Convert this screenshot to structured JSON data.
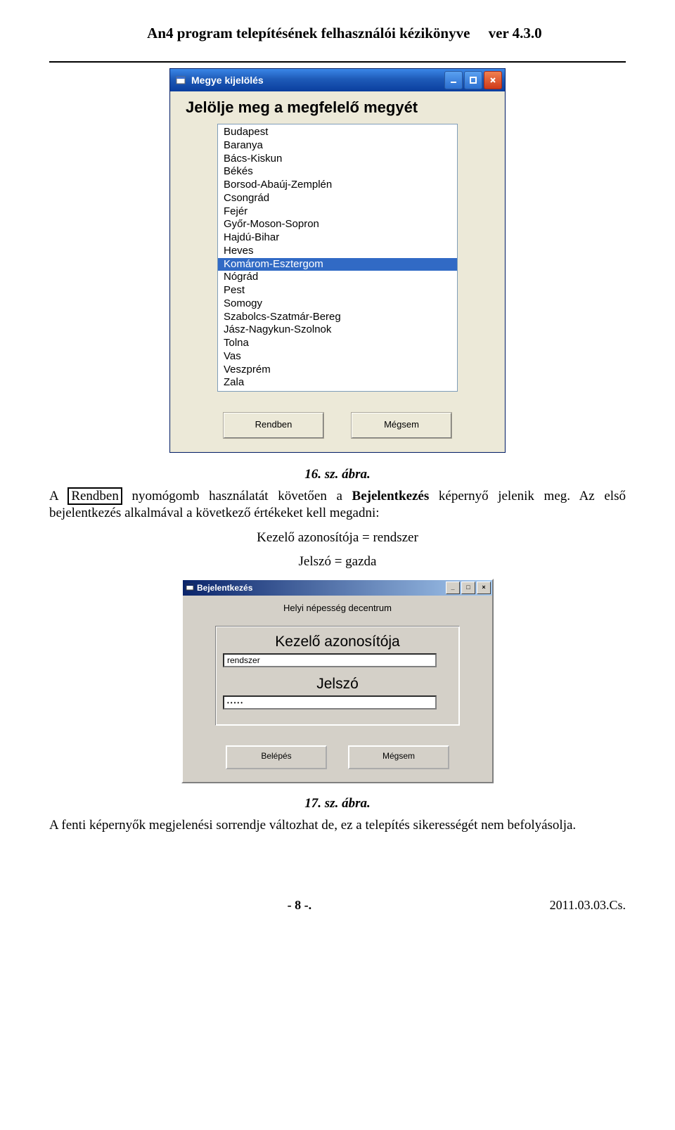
{
  "header": {
    "title_left": "An4 program telepítésének felhasználói kézikönyve",
    "title_right": "ver 4.3.0"
  },
  "figure1": {
    "window_title": "Megye kijelölés",
    "heading": "Jelölje meg a megfelelő megyét",
    "items": [
      "Budapest",
      "Baranya",
      "Bács-Kiskun",
      "Békés",
      "Borsod-Abaúj-Zemplén",
      "Csongrád",
      "Fejér",
      "Győr-Moson-Sopron",
      "Hajdú-Bihar",
      "Heves",
      "Komárom-Esztergom",
      "Nógrád",
      "Pest",
      "Somogy",
      "Szabolcs-Szatmár-Bereg",
      "Jász-Nagykun-Szolnok",
      "Tolna",
      "Vas",
      "Veszprém",
      "Zala"
    ],
    "selected_index": 10,
    "ok_label": "Rendben",
    "cancel_label": "Mégsem",
    "caption": "16. sz. ábra."
  },
  "para1": {
    "t1": "A ",
    "boxed": "Rendben",
    "t2": " nyomógomb használatát követően a ",
    "bold": "Bejelentkezés",
    "t3": " képernyő jelenik meg. Az első bejelentkezés alkalmával a következő értékeket kell megadni:",
    "line2": "Kezelő azonosítója = rendszer",
    "line3": "Jelszó = gazda"
  },
  "figure2": {
    "window_title": "Bejelentkezés",
    "subtitle": "Helyi népesség decentrum",
    "label_id": "Kezelő azonosítója",
    "value_id": "rendszer",
    "label_pw": "Jelszó",
    "value_pw_mask": "•••••",
    "btn_login": "Belépés",
    "btn_cancel": "Mégsem",
    "caption": "17. sz. ábra."
  },
  "para2": "A fenti képernyők megjelenési sorrendje változhat de, ez a telepítés sikerességét nem befolyásolja.",
  "footer": {
    "page": "- 8 -.",
    "date": "2011.03.03.Cs."
  }
}
